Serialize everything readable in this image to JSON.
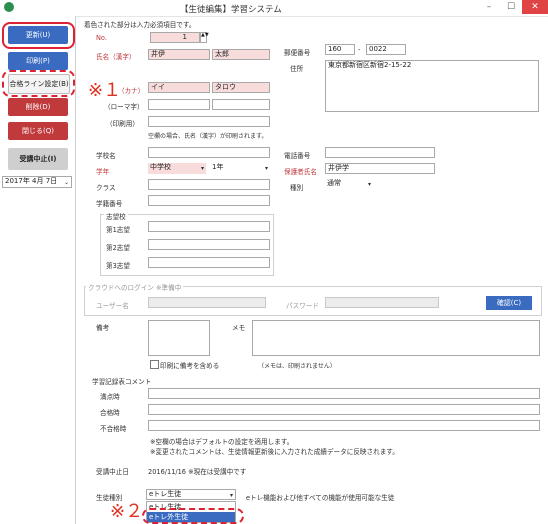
{
  "window": {
    "title": "【生徒編集】学習システム",
    "min": "–",
    "max": "☐",
    "close": "✕"
  },
  "sidebar": {
    "update": "更新(U)",
    "print": "印刷(P)",
    "pass_line": "合格ライン設定(B)",
    "delete": "削除(D)",
    "close": "閉じる(Q)",
    "suspend": "受講中止(I)",
    "date": "2017年 4月 7日"
  },
  "form": {
    "note": "着色された部分は入力必須項目です。",
    "no_label": "No.",
    "no_value": "1",
    "name_kanji_label": "氏名（漢字）",
    "last_kanji": "井伊",
    "first_kanji": "太郎",
    "kana_label": "（カナ）",
    "last_kana": "イイ",
    "first_kana": "タロウ",
    "roma_label": "（ローマ字）",
    "print_label": "（印刷用）",
    "print_note": "空欄の場合、氏名（漢字）が印刷されます。",
    "postal_label": "郵便番号",
    "postal1": "160",
    "postal_sep": "-",
    "postal2": "0022",
    "address_label": "住所",
    "address": "東京都新宿区新宿2-15-22",
    "school_label": "学校名",
    "phone_label": "電話番号",
    "grade_label": "学年",
    "grade_school": "中学校",
    "grade_year": "1年",
    "guardian_label": "保護者氏名",
    "guardian": "井伊学",
    "class_label": "クラス",
    "type_label": "種別",
    "type_value": "通常",
    "student_no_label": "学籍番号",
    "wish_label": "志望校",
    "wish1": "第1志望",
    "wish2": "第2志望",
    "wish3": "第3志望",
    "cloud_label": "クラウドへのログイン ※準備中",
    "user_label": "ユーザー名",
    "pass_label": "パスワード",
    "confirm": "確認(C)",
    "remarks_label": "備考",
    "memo_label": "メモ",
    "print_remarks": "印刷に備考を含める",
    "memo_note": "（メモは、印刷されません）",
    "comment_label": "学習記録表コメント",
    "fullscore_label": "満点時",
    "pass_label2": "合格時",
    "fail_label": "不合格時",
    "comment_note1": "※空欄の場合はデフォルトの設定を適用します。",
    "comment_note2": "※変更されたコメントは、生徒情報更新後に入力された成績データに反映されます。",
    "suspend_label": "受講中止日",
    "suspend_value": "2016/11/16 ※現在は受講中です",
    "student_type_label": "生徒種別",
    "student_type_value": "eトレ生徒",
    "student_type_desc": "eトレ機能および他すべての機能が使用可能な生徒",
    "opt1": "eトレ生徒",
    "opt2": "eトレ外生徒"
  },
  "annotations": {
    "mark1": "※１",
    "mark2": "※２"
  }
}
